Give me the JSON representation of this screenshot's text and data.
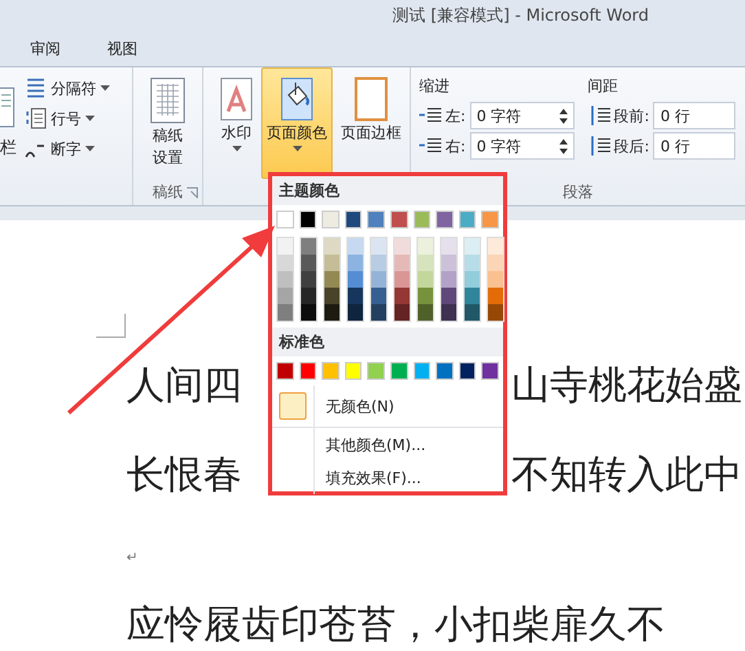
{
  "window": {
    "title": "测试 [兼容模式]  -  Microsoft Word"
  },
  "tabs": [
    {
      "label": "审阅",
      "selected": false
    },
    {
      "label": "视图",
      "selected": false
    }
  ],
  "ribbon": {
    "partial_group": {
      "button_label": "栏",
      "items": [
        {
          "kind": "breaks",
          "label": "分隔符"
        },
        {
          "kind": "line-numbers",
          "label": "行号"
        },
        {
          "kind": "hyphenation",
          "label": "断字"
        }
      ]
    },
    "manuscript_group": {
      "button_lines": [
        "稿纸",
        "设置"
      ],
      "group_label": "稿纸"
    },
    "background_group": {
      "buttons": [
        {
          "kind": "watermark",
          "label": "水印",
          "dropdown": true,
          "selected": false
        },
        {
          "kind": "page-color",
          "label": "页面颜色",
          "dropdown": true,
          "selected": true
        },
        {
          "kind": "page-border",
          "label": "页面边框",
          "dropdown": false,
          "selected": false
        }
      ]
    },
    "paragraph_group": {
      "group_label": "段落",
      "columns": [
        {
          "title": "缩进",
          "fields": [
            {
              "kind": "indent-left",
              "label": "左:",
              "value": "0 字符"
            },
            {
              "kind": "indent-right",
              "label": "右:",
              "value": "0 字符"
            }
          ]
        },
        {
          "title": "间距",
          "fields": [
            {
              "kind": "space-before",
              "label": "段前:",
              "value": "0 行"
            },
            {
              "kind": "space-after",
              "label": "段后:",
              "value": "0 行"
            }
          ]
        }
      ]
    }
  },
  "color_menu": {
    "theme_header": "主题颜色",
    "theme_colors": [
      {
        "color": "#ffffff",
        "shades": [
          {
            "color": "#f2f2f2"
          },
          {
            "color": "#d8d8d8"
          },
          {
            "color": "#bfbfbf"
          },
          {
            "color": "#a5a5a5"
          },
          {
            "color": "#7f7f7f"
          }
        ]
      },
      {
        "color": "#000000",
        "shades": [
          {
            "color": "#7f7f7f"
          },
          {
            "color": "#595959"
          },
          {
            "color": "#3f3f3f"
          },
          {
            "color": "#262626"
          },
          {
            "color": "#0c0c0c"
          }
        ]
      },
      {
        "color": "#eeece1",
        "shades": [
          {
            "color": "#ddd9c3"
          },
          {
            "color": "#c4bd97"
          },
          {
            "color": "#938953"
          },
          {
            "color": "#494429"
          },
          {
            "color": "#1d1b10"
          }
        ]
      },
      {
        "color": "#1f497d",
        "shades": [
          {
            "color": "#c6d9f0"
          },
          {
            "color": "#8db3e2"
          },
          {
            "color": "#548dd4"
          },
          {
            "color": "#17365d"
          },
          {
            "color": "#0f243e"
          }
        ]
      },
      {
        "color": "#4f81bd",
        "shades": [
          {
            "color": "#dbe5f1"
          },
          {
            "color": "#b8cce4"
          },
          {
            "color": "#95b3d7"
          },
          {
            "color": "#366092"
          },
          {
            "color": "#244061"
          }
        ]
      },
      {
        "color": "#c0504d",
        "shades": [
          {
            "color": "#f2dcdb"
          },
          {
            "color": "#e5b9b7"
          },
          {
            "color": "#d99694"
          },
          {
            "color": "#953734"
          },
          {
            "color": "#632423"
          }
        ]
      },
      {
        "color": "#9bbb59",
        "shades": [
          {
            "color": "#ebf1dd"
          },
          {
            "color": "#d7e3bc"
          },
          {
            "color": "#c3d69b"
          },
          {
            "color": "#76923c"
          },
          {
            "color": "#4f6128"
          }
        ]
      },
      {
        "color": "#8064a2",
        "shades": [
          {
            "color": "#e5e0ec"
          },
          {
            "color": "#ccc1d9"
          },
          {
            "color": "#b2a2c7"
          },
          {
            "color": "#5f497a"
          },
          {
            "color": "#3f3151"
          }
        ]
      },
      {
        "color": "#4bacc6",
        "shades": [
          {
            "color": "#dbeef3"
          },
          {
            "color": "#b7dde8"
          },
          {
            "color": "#92cddc"
          },
          {
            "color": "#31859b"
          },
          {
            "color": "#205867"
          }
        ]
      },
      {
        "color": "#f79646",
        "shades": [
          {
            "color": "#fdeada"
          },
          {
            "color": "#fbd5b5"
          },
          {
            "color": "#fac08f"
          },
          {
            "color": "#e36c09"
          },
          {
            "color": "#974806"
          }
        ]
      }
    ],
    "standard_header": "标准色",
    "standard_colors": [
      {
        "color": "#c00000"
      },
      {
        "color": "#ff0000"
      },
      {
        "color": "#ffc000"
      },
      {
        "color": "#ffff00"
      },
      {
        "color": "#92d050"
      },
      {
        "color": "#00b050"
      },
      {
        "color": "#00b0f0"
      },
      {
        "color": "#0070c0"
      },
      {
        "color": "#002060"
      },
      {
        "color": "#7030a0"
      }
    ],
    "items": [
      {
        "kind": "no-color",
        "label": "无颜色(N)"
      },
      {
        "kind": "more",
        "label": "其他颜色(M)..."
      },
      {
        "kind": "fill",
        "label": "填充效果(F)..."
      }
    ]
  },
  "document": {
    "lines": [
      {
        "kind": "text",
        "segments": [
          "人间四",
          "山寺桃花始盛"
        ]
      },
      {
        "kind": "text",
        "segments": [
          "长恨春",
          "不知转入此中"
        ]
      },
      {
        "kind": "mark",
        "text": "↵"
      },
      {
        "kind": "text",
        "segments": [
          "应怜屐齿印苍苔，小扣柴扉久不"
        ]
      }
    ]
  }
}
